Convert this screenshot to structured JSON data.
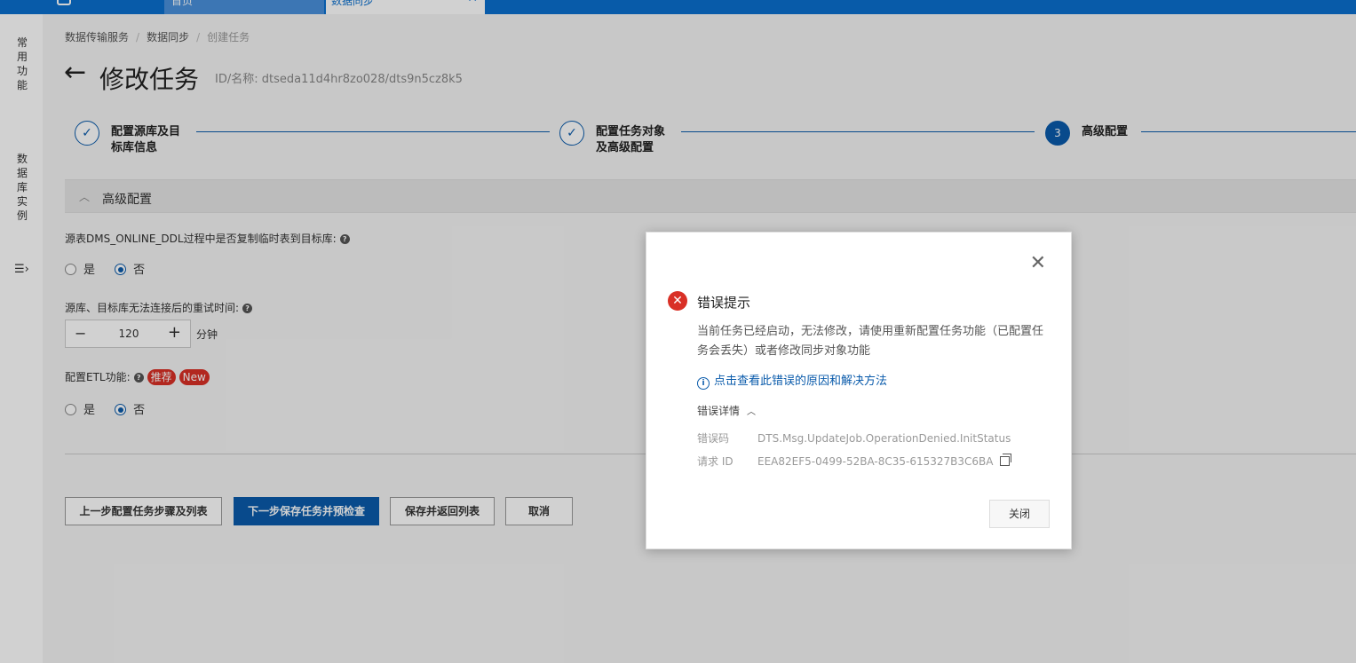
{
  "topbar": {
    "tab1_label": "首页",
    "tab2_label": "数据同步"
  },
  "sidebar": {
    "item1": "常用功能",
    "item2": "数据库实例",
    "menu_icon": "expand-menu-icon"
  },
  "breadcrumb": [
    "数据传输服务",
    "数据同步",
    "创建任务"
  ],
  "header": {
    "title": "修改任务",
    "id_label": "ID/名称: dtseda11d4hr8zo028/dts9n5cz8k5"
  },
  "steps": [
    {
      "label_line1": "配置源库及目",
      "label_line2": "标库信息",
      "status": "done"
    },
    {
      "label_line1": "配置任务对象",
      "label_line2": "及高级配置",
      "status": "done"
    },
    {
      "number": "3",
      "label_line1": "高级配置",
      "status": "active"
    }
  ],
  "section": {
    "title": "高级配置"
  },
  "form": {
    "q1": {
      "label": "源表DMS_ONLINE_DDL过程中是否复制临时表到目标库:",
      "options": [
        "是",
        "否"
      ],
      "selected": "否"
    },
    "q2": {
      "label": "源库、目标库无法连接后的重试时间:",
      "value": "120",
      "unit": "分钟"
    },
    "q3": {
      "label": "配置ETL功能:",
      "badge1": "推荐",
      "badge2": "New",
      "options": [
        "是",
        "否"
      ],
      "selected": "否"
    }
  },
  "buttons": {
    "prev": "上一步配置任务步骤及列表",
    "next": "下一步保存任务并预检查",
    "save_return": "保存并返回列表",
    "cancel": "取消"
  },
  "modal": {
    "title": "错误提示",
    "message": "当前任务已经启动，无法修改，请使用重新配置任务功能（已配置任务会丢失）或者修改同步对象功能",
    "link": "点击查看此错误的原因和解决方法",
    "details_label": "错误详情",
    "error_code_key": "错误码",
    "error_code_value": "DTS.Msg.UpdateJob.OperationDenied.InitStatus",
    "request_id_key": "请求 ID",
    "request_id_value": "EEA82EF5-0499-52BA-8C35-615327B3C6BA",
    "close_button": "关闭"
  },
  "colors": {
    "brand_blue": "#0a5bab",
    "topbar_blue": "#0a6fcf",
    "error_red": "#d93026"
  }
}
